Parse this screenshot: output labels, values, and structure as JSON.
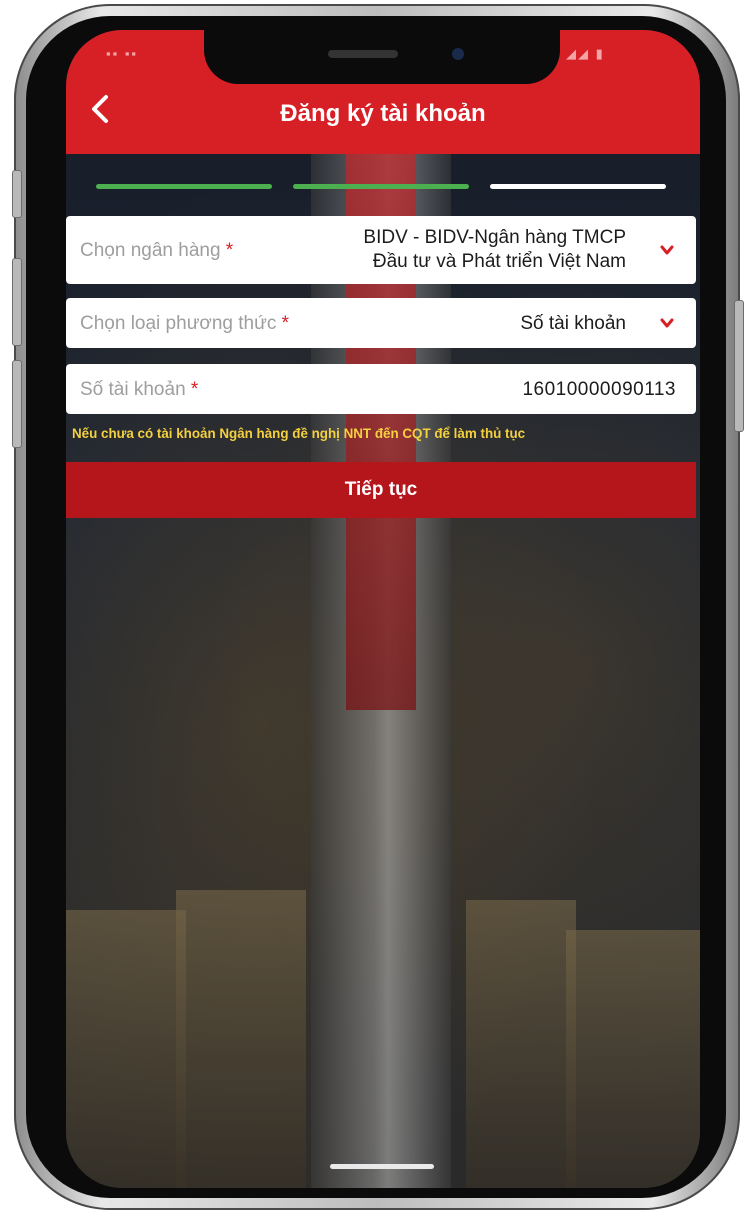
{
  "header": {
    "title": "Đăng ký tài khoản",
    "back_icon": "chevron-left-icon"
  },
  "progress": {
    "steps": [
      {
        "state": "done",
        "color": "#4caf50"
      },
      {
        "state": "done",
        "color": "#4caf50"
      },
      {
        "state": "current",
        "color": "#ffffff"
      }
    ]
  },
  "form": {
    "bank": {
      "label": "Chọn ngân hàng",
      "required_mark": "*",
      "value_line1": "BIDV - BIDV-Ngân hàng TMCP",
      "value_line2": "Đầu tư và Phát triển Việt Nam"
    },
    "method": {
      "label": "Chọn loại phương thức",
      "required_mark": "*",
      "value": "Số tài khoản"
    },
    "account": {
      "label": "Số tài khoản",
      "required_mark": "*",
      "value": "16010000090113"
    },
    "hint": "Nếu chưa có tài khoản Ngân hàng đề nghị NNT đến CQT để làm thủ tục"
  },
  "actions": {
    "continue_label": "Tiếp tục"
  },
  "colors": {
    "brand_red": "#d71f26",
    "button_red": "#b5161c",
    "hint_yellow": "#f4d03f"
  }
}
